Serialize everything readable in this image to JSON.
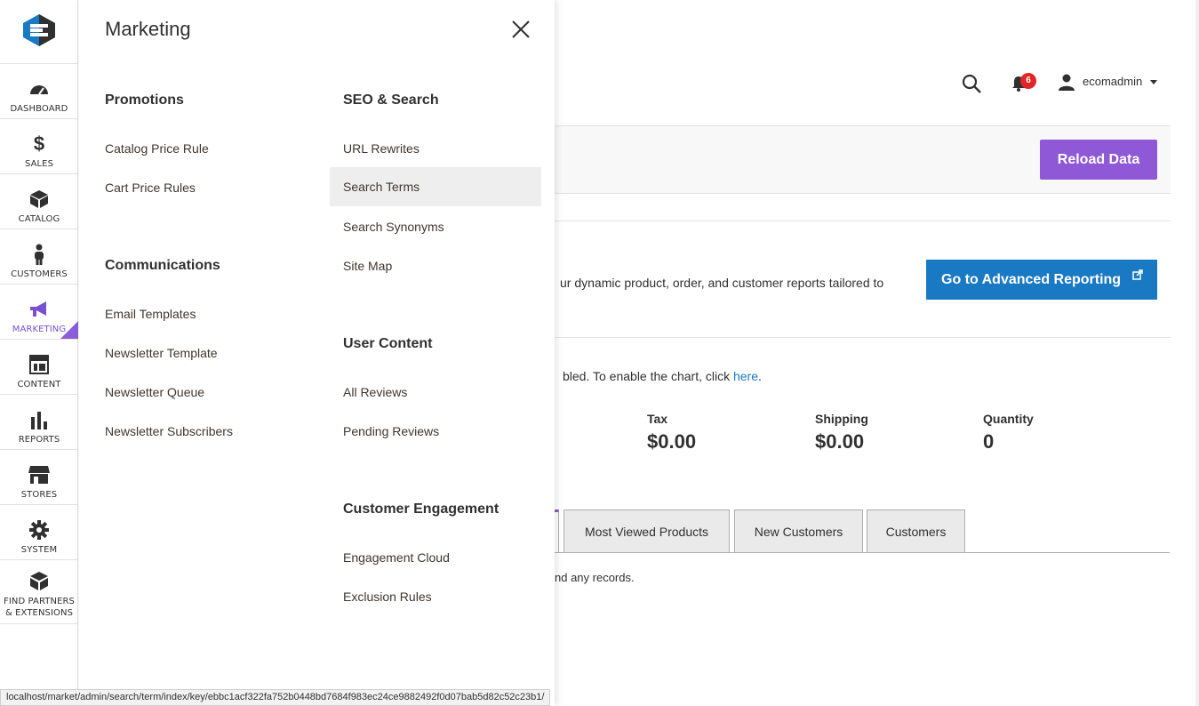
{
  "sidebar": {
    "items": [
      {
        "label": "DASHBOARD",
        "icon": "dashboard-icon"
      },
      {
        "label": "SALES",
        "icon": "dollar-icon"
      },
      {
        "label": "CATALOG",
        "icon": "box-icon"
      },
      {
        "label": "CUSTOMERS",
        "icon": "person-icon"
      },
      {
        "label": "MARKETING",
        "icon": "megaphone-icon",
        "active": true
      },
      {
        "label": "CONTENT",
        "icon": "layout-icon"
      },
      {
        "label": "REPORTS",
        "icon": "bar-chart-icon"
      },
      {
        "label": "STORES",
        "icon": "store-icon"
      },
      {
        "label": "SYSTEM",
        "icon": "gear-icon"
      },
      {
        "label": "FIND PARTNERS\n& EXTENSIONS",
        "line1": "FIND PARTNERS",
        "line2": "& EXTENSIONS",
        "icon": "extensions-icon"
      }
    ]
  },
  "flyout": {
    "title": "Marketing",
    "left_column": [
      {
        "title": "Promotions",
        "items": [
          "Catalog Price Rule",
          "Cart Price Rules"
        ]
      },
      {
        "title": "Communications",
        "items": [
          "Email Templates",
          "Newsletter Template",
          "Newsletter Queue",
          "Newsletter Subscribers"
        ]
      }
    ],
    "right_column": [
      {
        "title": "SEO & Search",
        "items": [
          "URL Rewrites",
          "Search Terms",
          "Search Synonyms",
          "Site Map"
        ],
        "highlighted": "Search Terms"
      },
      {
        "title": "User Content",
        "items": [
          "All Reviews",
          "Pending Reviews"
        ]
      },
      {
        "title": "Customer Engagement",
        "items": [
          "Engagement Cloud",
          "Exclusion Rules"
        ]
      }
    ]
  },
  "header": {
    "notification_count": "6",
    "username": "ecomadmin"
  },
  "actions": {
    "reload_label": "Reload Data"
  },
  "advanced": {
    "text": "ur dynamic product, order, and customer reports tailored to",
    "button_label": "Go to Advanced Reporting"
  },
  "chart_notice": {
    "text": "bled. To enable the chart, click ",
    "link": "here",
    "suffix": "."
  },
  "stats": [
    {
      "label": "Tax",
      "value": "$0.00"
    },
    {
      "label": "Shipping",
      "value": "$0.00"
    },
    {
      "label": "Quantity",
      "value": "0"
    }
  ],
  "tabs": [
    "Most Viewed Products",
    "New Customers",
    "Customers"
  ],
  "grid": {
    "empty_text": "nd any records."
  },
  "status_bar": {
    "url": "localhost/market/admin/search/term/index/key/ebbc1acf322fa752b0448bd7684f983ec24ce9882492f0d07bab5d82c52c23b1/"
  },
  "colors": {
    "accent_purple": "#8f58d6",
    "link_blue": "#1979c3",
    "badge_red": "#e22626"
  }
}
